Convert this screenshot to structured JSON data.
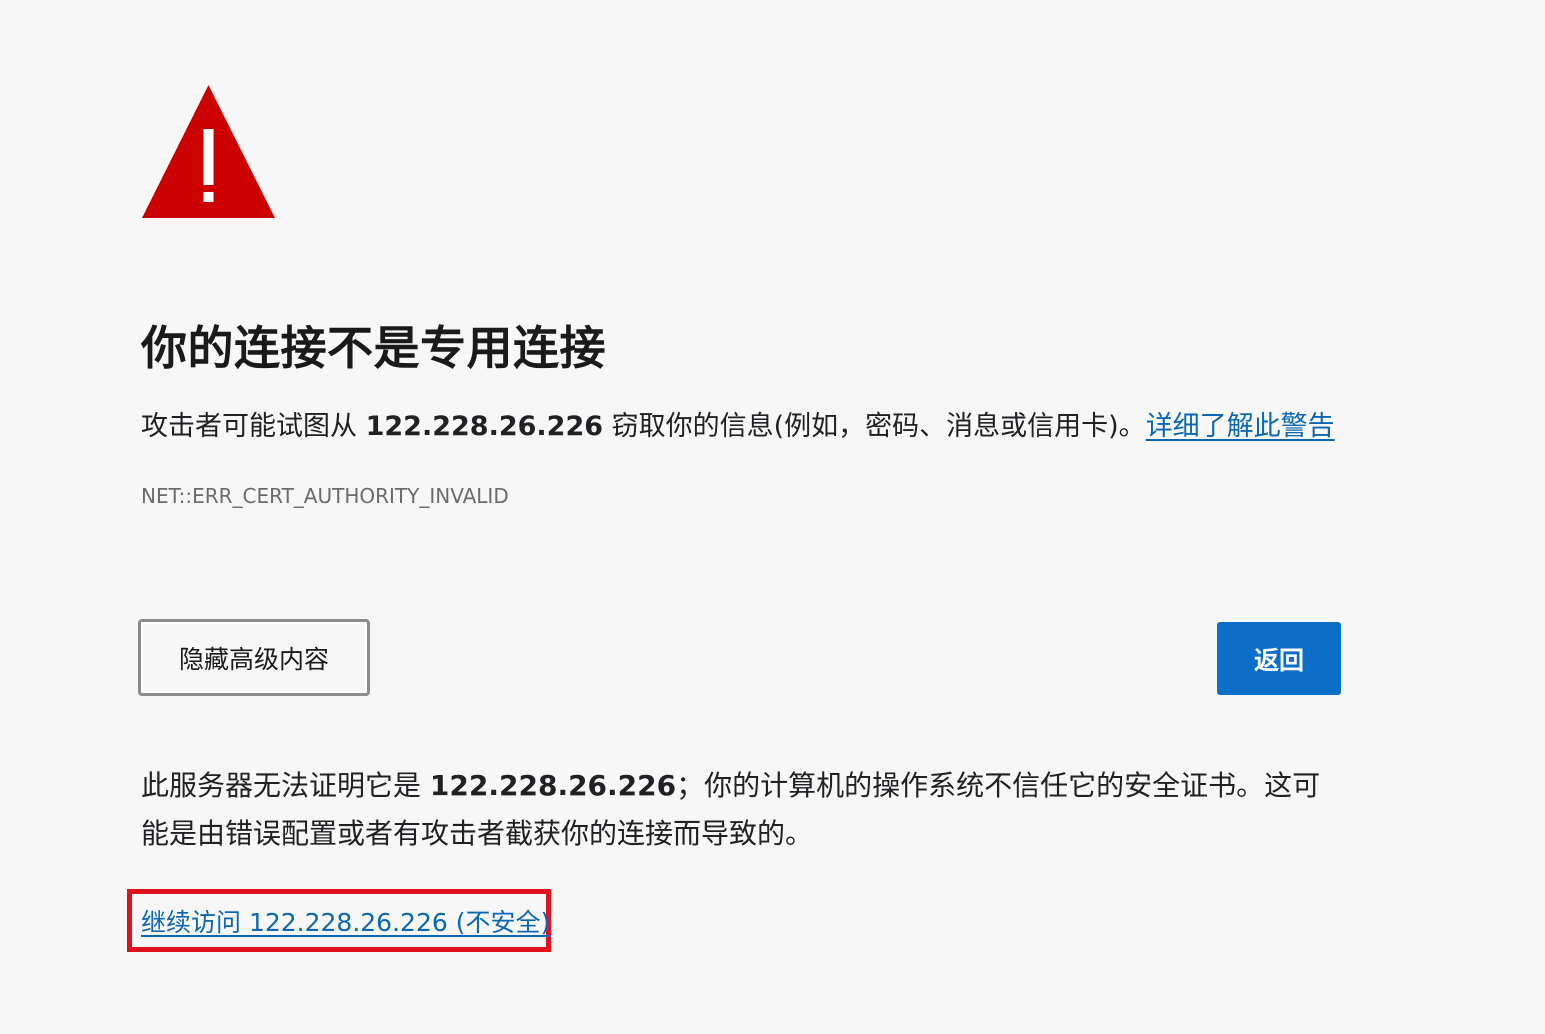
{
  "icon": {
    "name": "warning-triangle-icon",
    "color": "#cc0000",
    "glyph_color": "#ffffff"
  },
  "title": "你的连接不是专用连接",
  "message": {
    "before": "攻击者可能试图从 ",
    "host": "122.228.26.226",
    "after": " 窃取你的信息(例如，密码、消息或信用卡)。",
    "learn_more_link": "详细了解此警告"
  },
  "error_code": "NET::ERR_CERT_AUTHORITY_INVALID",
  "buttons": {
    "advanced_label": "隐藏高级内容",
    "back_label": "返回",
    "back_color": "#0b6fc9"
  },
  "details": {
    "before": "此服务器无法证明它是 ",
    "host": "122.228.26.226",
    "after": "；你的计算机的操作系统不信任它的安全证书。这可能是由错误配置或者有攻击者截获你的连接而导致的。"
  },
  "proceed": {
    "link_text": "继续访问 122.228.26.226 (不安全)",
    "highlight_color": "#e0121e",
    "link_color": "#0b67b3"
  }
}
